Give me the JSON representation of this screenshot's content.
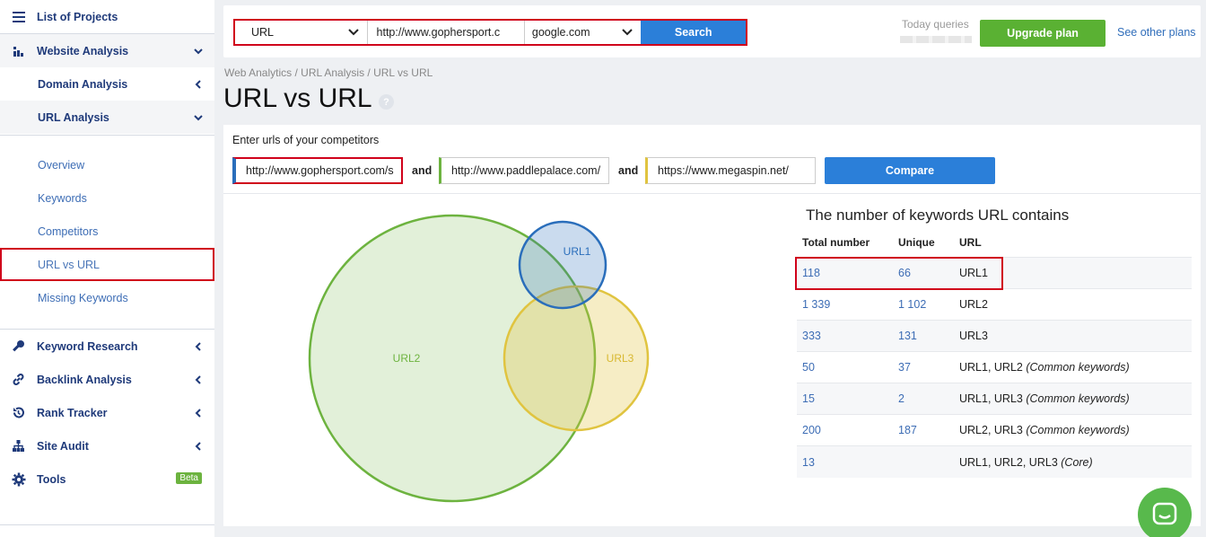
{
  "sidebar": {
    "projects": "List of Projects",
    "website_analysis": "Website Analysis",
    "domain_analysis": "Domain Analysis",
    "url_analysis": "URL Analysis",
    "leaves": [
      "Overview",
      "Keywords",
      "Competitors",
      "URL vs URL",
      "Missing Keywords"
    ],
    "keyword_research": "Keyword Research",
    "backlink_analysis": "Backlink Analysis",
    "rank_tracker": "Rank Tracker",
    "site_audit": "Site Audit",
    "tools": "Tools",
    "beta": "Beta"
  },
  "topbar": {
    "type_select": "URL",
    "url_value": "http://www.gophersport.c",
    "engine_select": "google.com",
    "search_label": "Search",
    "today_queries": "Today queries",
    "upgrade_label": "Upgrade plan",
    "other_plans": "See other plans"
  },
  "breadcrumb": "Web Analytics / URL Analysis / URL vs URL",
  "page_title": "URL vs URL",
  "compare": {
    "prompt": "Enter urls of your competitors",
    "url1": "http://www.gophersport.com/s",
    "url2": "http://www.paddlepalace.com/",
    "url3": "https://www.megaspin.net/",
    "and": "and",
    "button": "Compare"
  },
  "venn": {
    "labels": [
      "URL1",
      "URL2",
      "URL3"
    ],
    "colors": {
      "url1": "#2a6ebb",
      "url2": "#6db33f",
      "url3": "#e0c440"
    }
  },
  "keywords": {
    "title": "The number of keywords URL contains",
    "headers": [
      "Total number",
      "Unique",
      "URL"
    ],
    "rows": [
      {
        "total": "118",
        "unique": "66",
        "url": "URL1",
        "note": ""
      },
      {
        "total": "1 339",
        "unique": "1 102",
        "url": "URL2",
        "note": ""
      },
      {
        "total": "333",
        "unique": "131",
        "url": "URL3",
        "note": ""
      },
      {
        "total": "50",
        "unique": "37",
        "url": "URL1, URL2",
        "note": "(Common keywords)"
      },
      {
        "total": "15",
        "unique": "2",
        "url": "URL1, URL3",
        "note": "(Common keywords)"
      },
      {
        "total": "200",
        "unique": "187",
        "url": "URL2, URL3",
        "note": "(Common keywords)"
      },
      {
        "total": "13",
        "unique": "",
        "url": "URL1, URL2, URL3",
        "note": "(Core)"
      }
    ]
  }
}
